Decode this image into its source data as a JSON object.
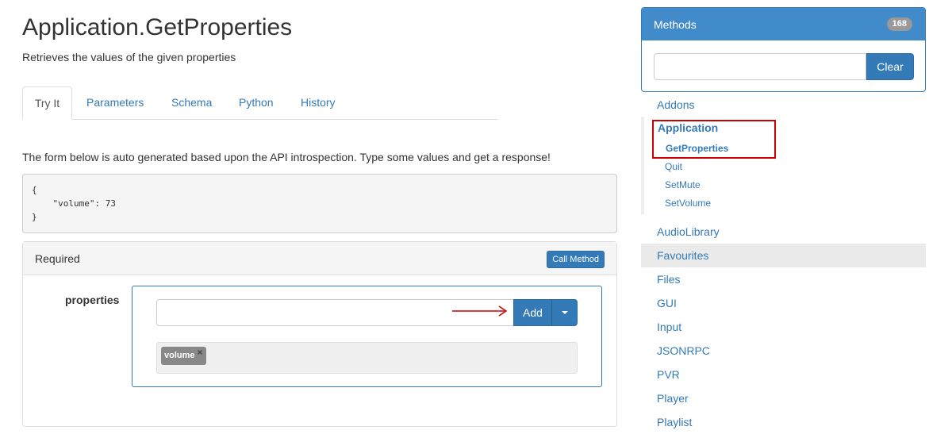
{
  "page": {
    "title": "Application.GetProperties",
    "subtitle": "Retrieves the values of the given properties"
  },
  "tabs": [
    {
      "label": "Try It",
      "active": true
    },
    {
      "label": "Parameters",
      "active": false
    },
    {
      "label": "Schema",
      "active": false
    },
    {
      "label": "Python",
      "active": false
    },
    {
      "label": "History",
      "active": false
    }
  ],
  "intro": "The form below is auto generated based upon the API introspection. Type some values and get a response!",
  "code": {
    "line1": "{",
    "line2": "    \"volume\": 73",
    "line3": "}"
  },
  "form": {
    "panel_label": "Required",
    "call_button": "Call Method",
    "field_label": "properties",
    "input_value": "",
    "add_button": "Add",
    "tags": [
      "volume"
    ],
    "tag_remove": "×"
  },
  "sidebar": {
    "header": "Methods",
    "count": "168",
    "filter_value": "",
    "clear_button": "Clear",
    "namespaces": [
      "Addons",
      "AudioLibrary",
      "Favourites",
      "Files",
      "GUI",
      "Input",
      "JSONRPC",
      "PVR",
      "Player",
      "Playlist"
    ],
    "expanded": {
      "name": "Application",
      "methods": [
        "GetProperties",
        "Quit",
        "SetMute",
        "SetVolume"
      ],
      "active_method": "GetProperties"
    },
    "hovered": "Favourites"
  },
  "colors": {
    "primary": "#337ab7",
    "sidebar_header": "#428bca",
    "highlight": "#cc0000"
  }
}
